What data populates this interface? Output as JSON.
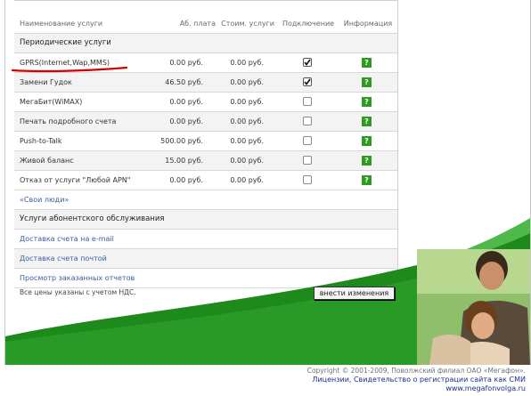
{
  "table": {
    "headers": {
      "name": "Наименование услуги",
      "fee": "Аб. плата",
      "cost": "Стоим. услуги",
      "connect": "Подключение",
      "info": "Информация"
    },
    "periodic_section": "Периодические услуги",
    "periodic_rows": [
      {
        "name": "GPRS(Internet,Wap,MMS)",
        "fee": "0.00 руб.",
        "cost": "0.00 руб.",
        "checked": true,
        "info_icon": "?"
      },
      {
        "name": "Замени Гудок",
        "fee": "46.50 руб.",
        "cost": "0.00 руб.",
        "checked": true,
        "info_icon": "?"
      },
      {
        "name": "МегаБит(WiMAX)",
        "fee": "0.00 руб.",
        "cost": "0.00 руб.",
        "checked": false,
        "info_icon": "?"
      },
      {
        "name": "Печать подробного счета",
        "fee": "0.00 руб.",
        "cost": "0.00 руб.",
        "checked": false,
        "info_icon": "?"
      },
      {
        "name": "Push-to-Talk",
        "fee": "500.00 руб.",
        "cost": "0.00 руб.",
        "checked": false,
        "info_icon": "?"
      },
      {
        "name": "Живой баланс",
        "fee": "15.00 руб.",
        "cost": "0.00 руб.",
        "checked": false,
        "info_icon": "?"
      },
      {
        "name": "Отказ от услуги \"Любой APN\"",
        "fee": "0.00 руб.",
        "cost": "0.00 руб.",
        "checked": false,
        "info_icon": "?"
      }
    ],
    "svoi_lyudi_link": "«Свои люди»",
    "subscriber_section": "Услуги абонентского обслуживания",
    "subscriber_links": [
      "Доставка счета на e-mail",
      "Доставка счета почтой",
      "Просмотр заказанных отчетов"
    ]
  },
  "vat_note": "Все цены указаны с учетом НДС.",
  "submit_label": "внести изменения",
  "footer": {
    "copyright": "Copyright © 2001-2009, Поволжский филиал ОАО «Мегафон».",
    "license": "Лицензии, Свидетельство о регистрации сайта как СМИ",
    "site": "www.megafonvolga.ru"
  },
  "colors": {
    "brand_green": "#1f8a1c",
    "info_icon": "#2e9a22",
    "link": "#3a5f9a",
    "annotation_underline": "#d40000"
  }
}
